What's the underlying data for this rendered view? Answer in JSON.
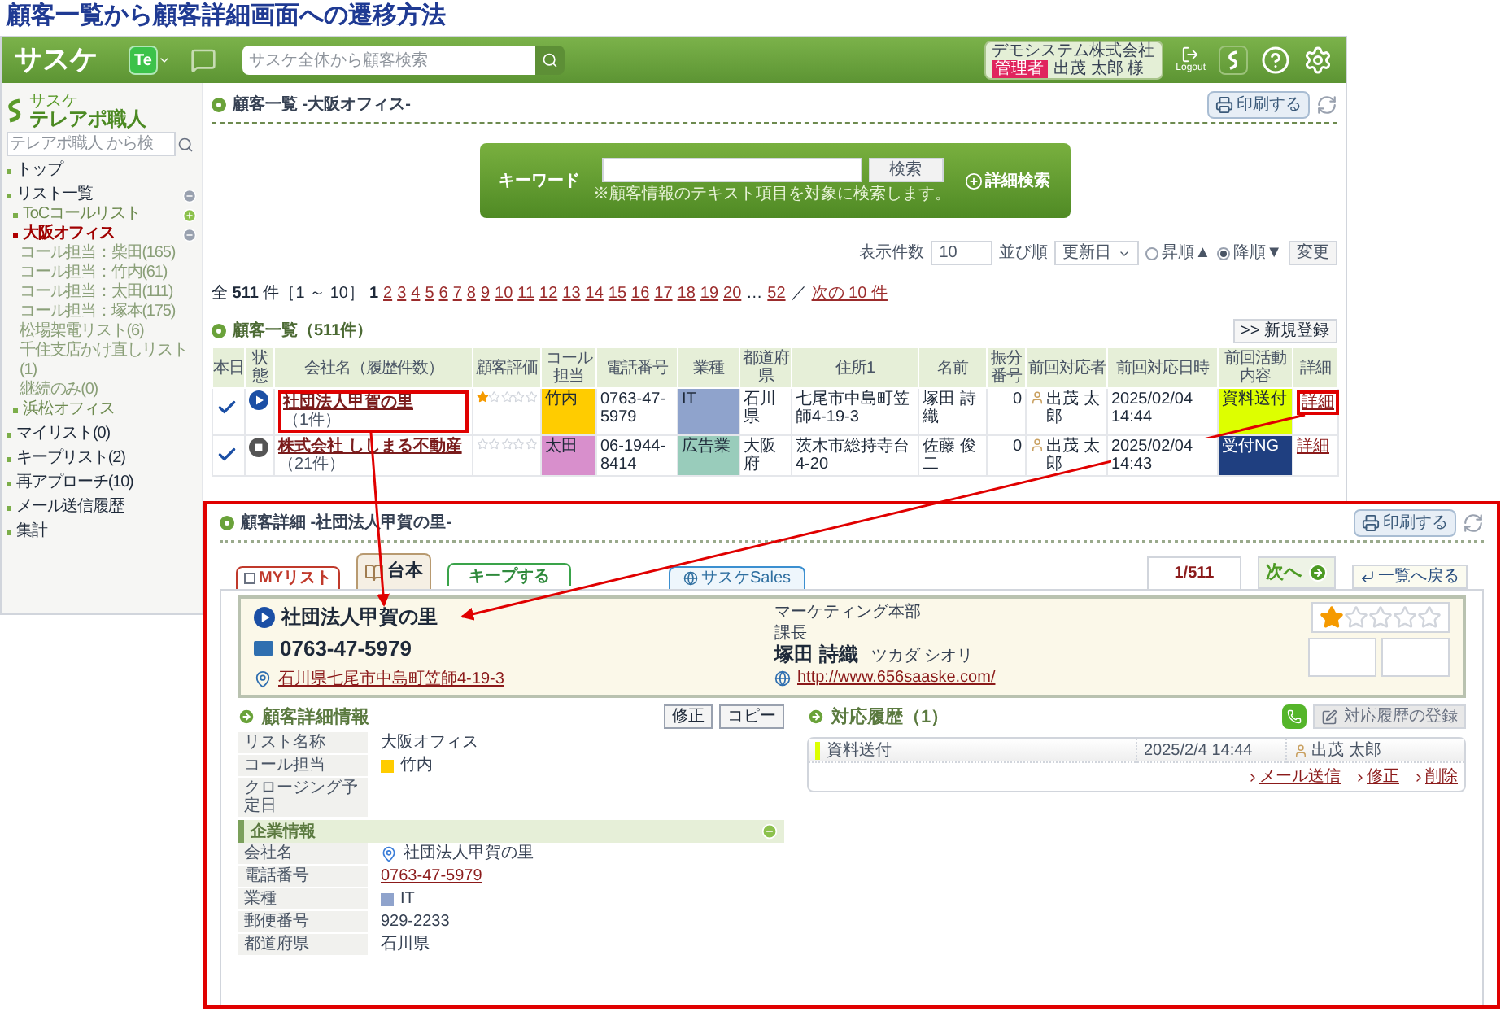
{
  "title": "顧客一覧から顧客詳細画面への遷移方法",
  "header": {
    "logo": "サスケ",
    "app_badge": "Te",
    "search_placeholder": "サスケ全体から顧客検索",
    "company": "デモシステム株式会社",
    "role": "管理者",
    "user": "出茂 太郎 様",
    "logout": "Logout"
  },
  "sidebar": {
    "brand_kana": "サスケ",
    "brand": "テレアポ職人",
    "search_placeholder": "テレアポ職人 から検",
    "items": [
      {
        "label": "トップ",
        "selected": false
      },
      {
        "label": "リスト一覧",
        "selected": false,
        "expanded": true,
        "children": [
          {
            "label": "ToCコールリスト",
            "selected": false,
            "expanded": false
          },
          {
            "label": "大阪オフィス",
            "selected": true,
            "expanded": true,
            "children": [
              {
                "label": "コール担当：柴田(165)",
                "selected": false
              },
              {
                "label": "コール担当：竹内(61)",
                "selected": false
              },
              {
                "label": "コール担当：太田(111)",
                "selected": false
              },
              {
                "label": "コール担当：塚本(175)",
                "selected": false
              },
              {
                "label": "松場架電リスト(6)",
                "selected": false
              },
              {
                "label": "千住支店かけ直しリスト(1)",
                "selected": false
              },
              {
                "label": "継続のみ(0)",
                "selected": false
              }
            ]
          },
          {
            "label": "浜松オフィス",
            "selected": false
          }
        ]
      },
      {
        "label": "マイリスト(0)",
        "selected": false
      },
      {
        "label": "キープリスト(2)",
        "selected": false
      },
      {
        "label": "再アプローチ(10)",
        "selected": false
      },
      {
        "label": "メール送信履歴",
        "selected": false
      },
      {
        "label": "集計",
        "selected": false
      }
    ]
  },
  "list": {
    "title": "顧客一覧 -大阪オフィス-",
    "print": "印刷する",
    "keyword": {
      "label": "キーワード",
      "button": "検索",
      "advanced": "詳細検索",
      "note": "※顧客情報のテキスト項目を対象に検索します。"
    },
    "sort": {
      "page_size_label": "表示件数",
      "page_size": "10",
      "sort_label": "並び順",
      "sort_value": "更新日",
      "orders": [
        {
          "label": "昇順▲",
          "selected": false
        },
        {
          "label": "降順▼",
          "selected": true
        }
      ],
      "apply": "変更"
    },
    "pagination": {
      "summary": "全 **511** 件［1 ～ 10］",
      "pages": [
        {
          "label": "1",
          "selected": true
        },
        {
          "label": "2",
          "selected": false
        },
        {
          "label": "3",
          "selected": false
        },
        {
          "label": "4",
          "selected": false
        },
        {
          "label": "5",
          "selected": false
        },
        {
          "label": "6",
          "selected": false
        },
        {
          "label": "7",
          "selected": false
        },
        {
          "label": "8",
          "selected": false
        },
        {
          "label": "9",
          "selected": false
        },
        {
          "label": "10",
          "selected": false
        },
        {
          "label": "11",
          "selected": false
        },
        {
          "label": "12",
          "selected": false
        },
        {
          "label": "13",
          "selected": false
        },
        {
          "label": "14",
          "selected": false
        },
        {
          "label": "15",
          "selected": false
        },
        {
          "label": "16",
          "selected": false
        },
        {
          "label": "17",
          "selected": false
        },
        {
          "label": "18",
          "selected": false
        },
        {
          "label": "19",
          "selected": false
        },
        {
          "label": "20",
          "selected": false
        }
      ],
      "ellipsis": "…",
      "last_page": "52",
      "separator": "／",
      "next": "次の 10 件"
    },
    "heading": "顧客一覧（511件）",
    "new_button": ">> 新規登録",
    "columns": [
      "本日",
      "状態",
      "会社名（履歴件数）",
      "顧客評価",
      "コール担当",
      "電話番号",
      "業種",
      "都道府県",
      "住所1",
      "名前",
      "振分番号",
      "前回対応者",
      "前回対応日時",
      "前回活動内容",
      "詳細"
    ],
    "rows": [
      {
        "active": true,
        "company": "社団法人甲賀の里",
        "count": "（1件）",
        "highlighted": true,
        "stars": 1,
        "caller": {
          "label": "竹内",
          "color": "#ffcc00"
        },
        "phone": "0763-47-5979",
        "industry": {
          "label": "IT",
          "color": "#8fa3cc"
        },
        "prefecture": "石川県",
        "address": "七尾市中島町笠師4-19-3",
        "name": "塚田 詩織",
        "assign_no": "0",
        "last_user": "出茂 太郎",
        "last_date": "2025/02/04 14:44",
        "activity": {
          "label": "資料送付",
          "color": "#ddff00"
        },
        "detail": "詳細",
        "detail_highlighted": true
      },
      {
        "active": false,
        "company": "株式会社 ししまる不動産",
        "count": "（21件）",
        "highlighted": false,
        "stars": 0,
        "caller": {
          "label": "太田",
          "color": "#d88fcc"
        },
        "phone": "06-1944-8414",
        "industry": {
          "label": "広告業",
          "color": "#99ccbb"
        },
        "prefecture": "大阪府",
        "address": "茨木市総持寺台4-20",
        "name": "佐藤 俊二",
        "assign_no": "0",
        "last_user": "出茂 太郎",
        "last_date": "2025/02/04 14:43",
        "activity": {
          "label": "受付NG",
          "color": "#1f3f80"
        },
        "detail": "詳細",
        "detail_highlighted": false
      }
    ]
  },
  "detail": {
    "title": "顧客詳細 -社団法人甲賀の里-",
    "print": "印刷する",
    "tabs": [
      {
        "kind": "mylist",
        "label": "MYリスト",
        "checked": false
      },
      {
        "kind": "script",
        "label": "台本"
      },
      {
        "kind": "keep",
        "label": "キープする"
      },
      {
        "kind": "sales",
        "label": "サスケSales"
      }
    ],
    "counter": "1/511",
    "next": "次へ",
    "back": "一覧へ戻る",
    "card": {
      "name": "社団法人甲賀の里",
      "phone": "0763-47-5979",
      "address": "石川県七尾市中島町笠師4-19-3",
      "department": "マーケティング本部",
      "position": "課長",
      "contact": "塚田 詩織",
      "contact_kana": "ツカダ シオリ",
      "url": "http://www.656saaske.com/",
      "stars": 1
    },
    "info": {
      "heading": "顧客詳細情報",
      "buttons": [
        "修正",
        "コピー"
      ],
      "rows": [
        {
          "label": "リスト名称",
          "kind": "text",
          "value": "大阪オフィス"
        },
        {
          "label": "コール担当",
          "kind": "swatch",
          "value": "竹内",
          "color": "#ffcc00"
        },
        {
          "label": "クロージング予定日",
          "kind": "empty"
        }
      ],
      "section": {
        "heading": "企業情報",
        "expanded": true,
        "rows": [
          {
            "label": "会社名",
            "kind": "map",
            "value": "社団法人甲賀の里"
          },
          {
            "label": "電話番号",
            "kind": "link",
            "value": "0763-47-5979"
          },
          {
            "label": "業種",
            "kind": "swatch",
            "value": "IT",
            "color": "#8fa3cc"
          },
          {
            "label": "郵便番号",
            "kind": "text",
            "value": "929-2233"
          },
          {
            "label": "都道府県",
            "kind": "text",
            "value": "石川県"
          }
        ]
      }
    },
    "history": {
      "heading": "対応履歴（1）",
      "register": "対応履歴の登録",
      "entries": [
        {
          "activity": "資料送付",
          "color": "#ddff00",
          "date": "2025/2/4 14:44",
          "user": "出茂 太郎"
        }
      ],
      "links": [
        "メール送信",
        "修正",
        "削除"
      ]
    }
  }
}
